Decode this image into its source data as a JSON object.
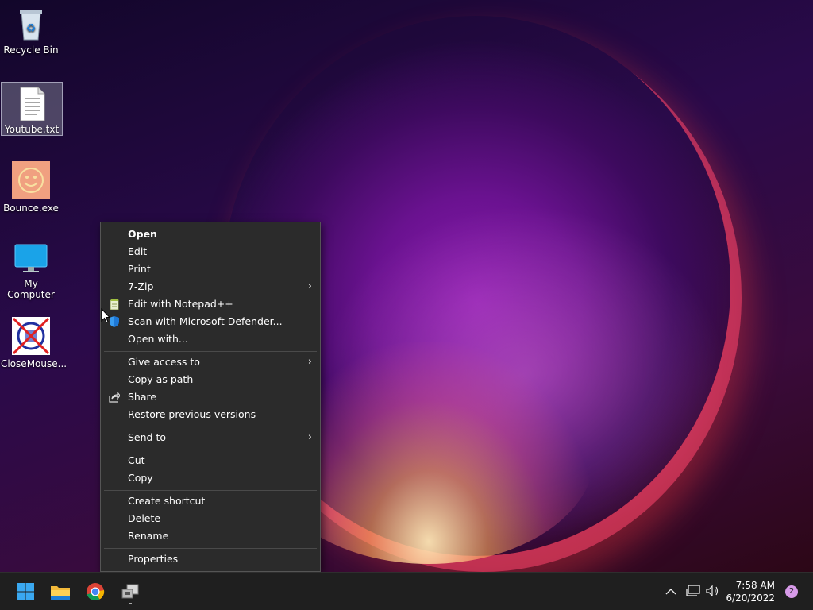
{
  "desktop": {
    "icons": [
      {
        "label": "Recycle Bin",
        "icon": "recycle-bin-icon"
      },
      {
        "label": "Youtube.txt",
        "icon": "text-file-icon"
      },
      {
        "label": "Bounce.exe",
        "icon": "smiley-app-icon"
      },
      {
        "label": "My Computer",
        "icon": "monitor-icon"
      },
      {
        "label": "CloseMouse...",
        "icon": "blocked-mouse-icon"
      }
    ]
  },
  "context_menu": {
    "items": [
      {
        "label": "Open",
        "bold": true
      },
      {
        "label": "Edit"
      },
      {
        "label": "Print"
      },
      {
        "label": "7-Zip",
        "submenu": true
      },
      {
        "label": "Edit with Notepad++",
        "icon": "notepadpp-icon"
      },
      {
        "label": "Scan with Microsoft Defender...",
        "icon": "defender-shield-icon"
      },
      {
        "label": "Open with..."
      },
      {
        "label": "Give access to",
        "submenu": true
      },
      {
        "label": "Copy as path"
      },
      {
        "label": "Share",
        "icon": "share-icon"
      },
      {
        "label": "Restore previous versions"
      },
      {
        "label": "Send to",
        "submenu": true
      },
      {
        "label": "Cut"
      },
      {
        "label": "Copy"
      },
      {
        "label": "Create shortcut"
      },
      {
        "label": "Delete"
      },
      {
        "label": "Rename"
      },
      {
        "label": "Properties"
      }
    ],
    "submenu_arrow": "›"
  },
  "taskbar": {
    "apps": [
      "windows-start-icon",
      "file-explorer-icon",
      "chrome-icon",
      "network-app-icon"
    ],
    "tray": {
      "chevron": "^",
      "time": "7:58 AM",
      "date": "6/20/2022",
      "notification_count": "2"
    }
  },
  "colors": {
    "menu_bg": "#2b2b2b",
    "taskbar_bg": "#1f1f1f",
    "badge": "#d79ae8"
  }
}
